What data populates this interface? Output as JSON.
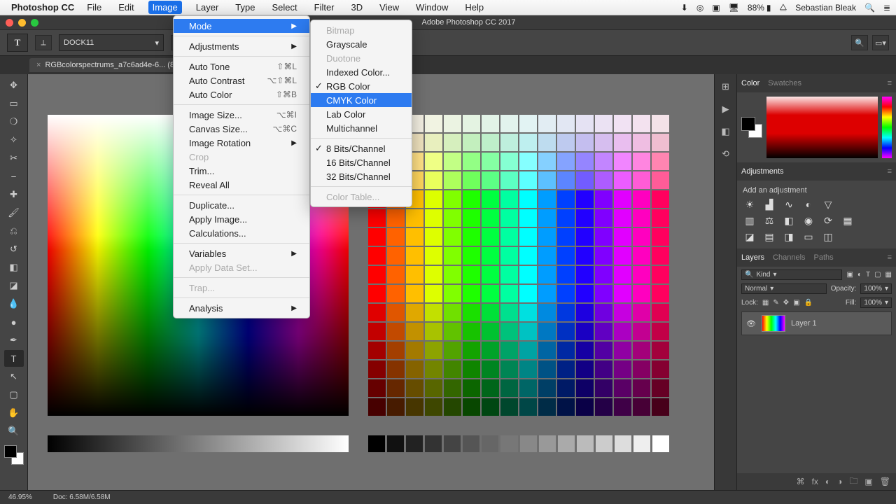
{
  "menubar": {
    "app": "Photoshop CC",
    "items": [
      "File",
      "Edit",
      "Image",
      "Layer",
      "Type",
      "Select",
      "Filter",
      "3D",
      "View",
      "Window",
      "Help"
    ],
    "active_index": 2,
    "right": {
      "battery": "88%",
      "user": "Sebastian Bleak"
    }
  },
  "window": {
    "title": "Adobe Photoshop CC 2017"
  },
  "options_bar": {
    "tool_glyph": "T",
    "font_name": "DOCK11"
  },
  "document_tab": {
    "name": "RGBcolorspectrums_a7c6ad4e-6...  (8) *"
  },
  "image_menu": [
    {
      "label": "Mode",
      "highlight": true,
      "submenu": true
    },
    {
      "sep": true
    },
    {
      "label": "Adjustments",
      "submenu": true
    },
    {
      "sep": true
    },
    {
      "label": "Auto Tone",
      "shortcut": "⇧⌘L"
    },
    {
      "label": "Auto Contrast",
      "shortcut": "⌥⇧⌘L"
    },
    {
      "label": "Auto Color",
      "shortcut": "⇧⌘B"
    },
    {
      "sep": true
    },
    {
      "label": "Image Size...",
      "shortcut": "⌥⌘I"
    },
    {
      "label": "Canvas Size...",
      "shortcut": "⌥⌘C"
    },
    {
      "label": "Image Rotation",
      "submenu": true
    },
    {
      "label": "Crop",
      "disabled": true
    },
    {
      "label": "Trim..."
    },
    {
      "label": "Reveal All"
    },
    {
      "sep": true
    },
    {
      "label": "Duplicate..."
    },
    {
      "label": "Apply Image..."
    },
    {
      "label": "Calculations..."
    },
    {
      "sep": true
    },
    {
      "label": "Variables",
      "submenu": true
    },
    {
      "label": "Apply Data Set...",
      "disabled": true
    },
    {
      "sep": true
    },
    {
      "label": "Trap...",
      "disabled": true
    },
    {
      "sep": true
    },
    {
      "label": "Analysis",
      "submenu": true
    }
  ],
  "mode_submenu": [
    {
      "label": "Bitmap",
      "disabled": true
    },
    {
      "label": "Grayscale"
    },
    {
      "label": "Duotone",
      "disabled": true
    },
    {
      "label": "Indexed Color..."
    },
    {
      "label": "RGB Color",
      "checked": true
    },
    {
      "label": "CMYK Color",
      "highlight": true
    },
    {
      "label": "Lab Color"
    },
    {
      "label": "Multichannel"
    },
    {
      "sep": true
    },
    {
      "label": "8 Bits/Channel",
      "checked": true
    },
    {
      "label": "16 Bits/Channel"
    },
    {
      "label": "32 Bits/Channel"
    },
    {
      "sep": true
    },
    {
      "label": "Color Table...",
      "disabled": true
    }
  ],
  "tools": [
    {
      "name": "move-tool",
      "glyph": "✥"
    },
    {
      "name": "marquee-tool",
      "glyph": "▭"
    },
    {
      "name": "lasso-tool",
      "glyph": "❍"
    },
    {
      "name": "magic-wand-tool",
      "glyph": "✧"
    },
    {
      "name": "crop-tool",
      "glyph": "✂"
    },
    {
      "name": "eyedropper-tool",
      "glyph": "⎯"
    },
    {
      "name": "healing-brush-tool",
      "glyph": "✚"
    },
    {
      "name": "brush-tool",
      "glyph": "🖌"
    },
    {
      "name": "clone-stamp-tool",
      "glyph": "⎌"
    },
    {
      "name": "history-brush-tool",
      "glyph": "↺"
    },
    {
      "name": "eraser-tool",
      "glyph": "◧"
    },
    {
      "name": "gradient-tool",
      "glyph": "◪"
    },
    {
      "name": "blur-tool",
      "glyph": "💧"
    },
    {
      "name": "dodge-tool",
      "glyph": "●"
    },
    {
      "name": "pen-tool",
      "glyph": "✒"
    },
    {
      "name": "type-tool",
      "glyph": "T",
      "selected": true
    },
    {
      "name": "path-selection-tool",
      "glyph": "↖"
    },
    {
      "name": "rectangle-tool",
      "glyph": "▢"
    },
    {
      "name": "hand-tool",
      "glyph": "✋"
    },
    {
      "name": "zoom-tool",
      "glyph": "🔍"
    }
  ],
  "panels": {
    "color_tabs": [
      "Color",
      "Swatches"
    ],
    "adjustments_tab": "Adjustments",
    "adjustments_title": "Add an adjustment",
    "layer_tabs": [
      "Layers",
      "Channels",
      "Paths"
    ],
    "kind_label": "Kind",
    "blend_mode": "Normal",
    "opacity_label": "Opacity:",
    "opacity_value": "100%",
    "lock_label": "Lock:",
    "fill_label": "Fill:",
    "fill_value": "100%",
    "layer_name": "Layer 1"
  },
  "status": {
    "zoom": "46.95%",
    "doc": "Doc: 6.58M/6.58M"
  }
}
